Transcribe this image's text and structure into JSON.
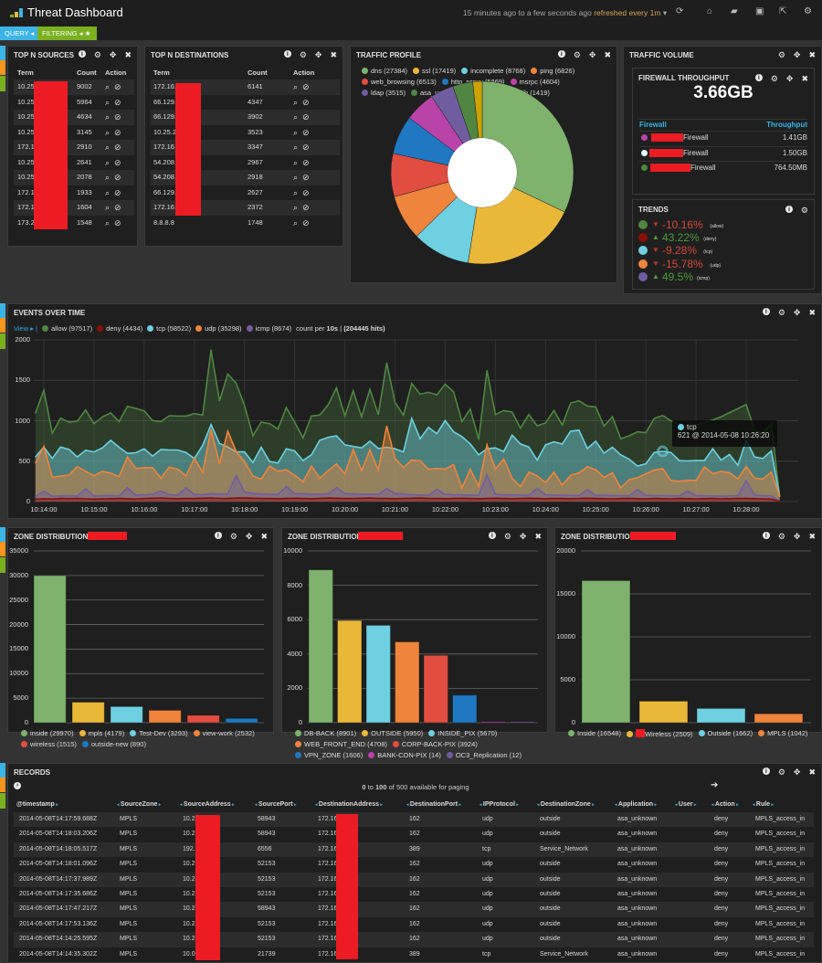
{
  "header": {
    "title": "Threat Dashboard",
    "time_range": "15 minutes ago to a few seconds ago",
    "refresh": "refreshed every 1m",
    "icons": [
      "refresh-icon",
      "home-icon",
      "folder-open-icon",
      "save-icon",
      "share-icon",
      "gear-icon"
    ]
  },
  "subnav": {
    "query": "QUERY",
    "filtering": "FILTERING"
  },
  "colors": {
    "query": "#3cb4e6",
    "filtering": "#7bb020",
    "strip_orange": "#f7941d",
    "redaction": "#ed1c24",
    "link": "#33b5e5"
  },
  "top_sources": {
    "title": "TOP N SOURCES",
    "columns": [
      "Term",
      "Count",
      "Action"
    ],
    "rows": [
      {
        "term": "10.25",
        "count": "9002"
      },
      {
        "term": "10.25",
        "count": "5964"
      },
      {
        "term": "10.25",
        "count": "4634"
      },
      {
        "term": "10.25",
        "count": "3145"
      },
      {
        "term": "172.1",
        "count": "2910"
      },
      {
        "term": "10.25",
        "count": "2641"
      },
      {
        "term": "10.25",
        "count": "2078"
      },
      {
        "term": "172.1",
        "count": "1933"
      },
      {
        "term": "172.1",
        "count": "1604"
      },
      {
        "term": "173.2",
        "count": "1548"
      }
    ]
  },
  "top_destinations": {
    "title": "TOP N DESTINATIONS",
    "columns": [
      "Term",
      "Count",
      "Action"
    ],
    "rows": [
      {
        "term": "172.16.",
        "count": "6141"
      },
      {
        "term": "66.129.",
        "count": "4347"
      },
      {
        "term": "66.129.",
        "count": "3902"
      },
      {
        "term": "10.25.2",
        "count": "3523"
      },
      {
        "term": "172.16.",
        "count": "3347"
      },
      {
        "term": "54.208.",
        "count": "2967"
      },
      {
        "term": "54.208.",
        "count": "2918"
      },
      {
        "term": "66.129.",
        "count": "2627"
      },
      {
        "term": "172.16.",
        "count": "2372"
      },
      {
        "term": "8.8.8.8",
        "count": "1748"
      }
    ]
  },
  "traffic_profile": {
    "title": "TRAFFIC PROFILE"
  },
  "traffic_volume": {
    "title": "TRAFFIC VOLUME",
    "throughput": {
      "title": "FIREWALL THROUGHPUT",
      "total": "3.66GB",
      "columns": [
        "Firewall",
        "Throughput"
      ],
      "rows": [
        {
          "name": "Firewall",
          "value": "1.41GB",
          "color": "#ba43a9"
        },
        {
          "name": "Firewall",
          "value": "1.50GB",
          "color": "#e0ffff"
        },
        {
          "name": "Firewall",
          "value": "764.50MB",
          "color": "#508642"
        }
      ]
    },
    "trends": {
      "title": "TRENDS",
      "items": [
        {
          "color": "#508642",
          "direction": "down",
          "value": "-10.16%",
          "label": "(allow)"
        },
        {
          "color": "#890f02",
          "direction": "up",
          "value": "43.22%",
          "label": "(deny)"
        },
        {
          "color": "#6ed0e0",
          "direction": "up-down",
          "value": "-9.28%",
          "label": "(tcp)"
        },
        {
          "color": "#ef843c",
          "direction": "down",
          "value": "-15.78%",
          "label": "(udp)"
        },
        {
          "color": "#705da0",
          "direction": "up",
          "value": "49.5%",
          "label": "(icmp)"
        }
      ]
    }
  },
  "events": {
    "title": "EVENTS OVER TIME",
    "view": "View",
    "count_text": "count per",
    "interval": "10s",
    "hits": "(204445 hits)",
    "tooltip": {
      "series": "tcp",
      "text": "621 @ 2014-05-08 10:26:20"
    }
  },
  "zones": [
    {
      "title": "ZONE DISTRIBUTION -"
    },
    {
      "title": "ZONE DISTRIBUTION -"
    },
    {
      "title": "ZONE DISTRIBUTION -"
    }
  ],
  "records": {
    "title": "RECORDS",
    "paging": {
      "from": "0",
      "to_word": "to",
      "to": "100",
      "rest": "of 500 available for paging"
    },
    "columns": [
      "@timestamp",
      "SourceZone",
      "SourceAddress",
      "SourcePort",
      "DestinationAddress",
      "DestinationPort",
      "IPProtocol",
      "DestinationZone",
      "Application",
      "User",
      "Action",
      "Rule"
    ],
    "rows": [
      [
        "2014-05-08T14:17:59.688Z",
        "MPLS",
        "10.25",
        "58943",
        "172.16.",
        "162",
        "udp",
        "outside",
        "asa_unknown",
        "",
        "deny",
        "MPLS_access_in"
      ],
      [
        "2014-05-08T14:18:03.206Z",
        "MPLS",
        "10.25",
        "58943",
        "172.16.",
        "162",
        "udp",
        "outside",
        "asa_unknown",
        "",
        "deny",
        "MPLS_access_in"
      ],
      [
        "2014-05-08T14:18:05.517Z",
        "MPLS",
        "192.1",
        "6556",
        "172.16.",
        "389",
        "tcp",
        "Service_Network",
        "asa_unknown",
        "",
        "deny",
        "MPLS_access_in"
      ],
      [
        "2014-05-08T14:18:01.096Z",
        "MPLS",
        "10.25",
        "52153",
        "172.16.",
        "162",
        "udp",
        "outside",
        "asa_unknown",
        "",
        "deny",
        "MPLS_access_in"
      ],
      [
        "2014-05-08T14:17:37.989Z",
        "MPLS",
        "10.25",
        "52153",
        "172.16.",
        "162",
        "udp",
        "outside",
        "asa_unknown",
        "",
        "deny",
        "MPLS_access_in"
      ],
      [
        "2014-05-08T14:17:35.686Z",
        "MPLS",
        "10.25",
        "52153",
        "172.16.",
        "162",
        "udp",
        "outside",
        "asa_unknown",
        "",
        "deny",
        "MPLS_access_in"
      ],
      [
        "2014-05-08T14:17:47.217Z",
        "MPLS",
        "10.25",
        "58943",
        "172.16.",
        "162",
        "udp",
        "outside",
        "asa_unknown",
        "",
        "deny",
        "MPLS_access_in"
      ],
      [
        "2014-05-08T14:17:53.136Z",
        "MPLS",
        "10.25",
        "52153",
        "172.16.",
        "162",
        "udp",
        "outside",
        "asa_unknown",
        "",
        "deny",
        "MPLS_access_in"
      ],
      [
        "2014-05-08T14:14:25.595Z",
        "MPLS",
        "10.25",
        "52153",
        "172.16.",
        "162",
        "udp",
        "outside",
        "asa_unknown",
        "",
        "deny",
        "MPLS_access_in"
      ],
      [
        "2014-05-08T14:14:35.302Z",
        "MPLS",
        "10.0.0",
        "21739",
        "172.16.",
        "389",
        "tcp",
        "Service_Network",
        "asa_unknown",
        "",
        "deny",
        "MPLS_access_in"
      ]
    ]
  },
  "chart_data": [
    {
      "type": "area",
      "title": "EVENTS OVER TIME",
      "start_time": "10:13:50",
      "interval": "10s",
      "ylim": [
        0,
        2000
      ],
      "yticks": [
        "0",
        "500",
        "1000",
        "1500",
        "2000"
      ],
      "xticks": [
        "10:14:00",
        "10:15:00",
        "10:16:00",
        "10:17:00",
        "10:18:00",
        "10:19:00",
        "10:20:00",
        "10:21:00",
        "10:22:00",
        "10:23:00",
        "10:24:00",
        "10:25:00",
        "10:26:00",
        "10:27:00",
        "10:28:00"
      ],
      "grid": true,
      "legend": "top-left",
      "series": [
        {
          "name": "allow",
          "total": "97517",
          "color": "#508642",
          "values": [
            1095,
            1377,
            845,
            1032,
            983,
            994,
            1133,
            964,
            1047,
            1096,
            990,
            1178,
            1152,
            1122,
            1002,
            990,
            1062,
            1058,
            1058,
            1088,
            1070,
            1876,
            1245,
            1576,
            1463,
            1190,
            814,
            983,
            964,
            897,
            1163,
            983,
            788,
            1058,
            1070,
            1197,
            1407,
            1058,
            1370,
            1047,
            1388,
            1077,
            1715,
            1227,
            1070,
            1460,
            1328,
            1351,
            1321,
            1452,
            1358,
            990,
            1145,
            769,
            1621,
            1077,
            1126,
            1107,
            908,
            1077,
            938,
            972,
            1126,
            946,
            1220,
            1246,
            1182,
            1171,
            934,
            1051,
            777,
            814,
            863,
            852,
            1028,
            1066,
            1000,
            960,
            930,
            950,
            980,
            1010,
            1050,
            1100,
            1150,
            1200,
            880,
            850,
            964,
            64
          ]
        },
        {
          "name": "deny",
          "total": "4434",
          "color": "#890f02",
          "values": [
            30,
            35,
            32,
            38,
            36,
            40,
            34,
            30,
            33,
            36,
            38,
            35,
            32,
            40,
            42,
            45,
            38,
            36,
            40,
            38,
            42,
            45,
            40,
            38,
            44,
            46,
            42,
            40,
            38,
            36,
            40,
            42,
            38,
            36,
            40,
            44,
            42,
            38,
            40,
            42,
            45,
            40,
            38,
            36,
            40,
            42,
            44,
            40,
            38,
            36,
            40,
            42,
            38,
            36,
            40,
            42,
            38,
            36,
            40,
            42,
            38,
            36,
            40,
            38,
            36,
            40,
            42,
            38,
            36,
            34,
            38,
            40,
            36,
            34,
            38,
            36,
            34,
            38,
            36,
            34,
            36,
            38,
            34,
            36,
            38,
            40,
            36,
            34,
            30,
            5
          ]
        },
        {
          "name": "tcp",
          "total": "58522",
          "color": "#6ed0e0",
          "values": [
            552,
            675,
            533,
            675,
            645,
            552,
            634,
            615,
            664,
            758,
            672,
            597,
            604,
            653,
            563,
            645,
            638,
            638,
            608,
            533,
            694,
            953,
            720,
            675,
            615,
            615,
            484,
            672,
            495,
            477,
            653,
            627,
            507,
            578,
            758,
            795,
            814,
            702,
            683,
            664,
            747,
            657,
            672,
            653,
            615,
            1028,
            777,
            919,
            841,
            1002,
            863,
            803,
            713,
            578,
            653,
            664,
            619,
            822,
            713,
            675,
            514,
            702,
            739,
            713,
            871,
            882,
            657,
            747,
            600,
            672,
            578,
            525,
            439,
            469,
            608,
            621,
            608,
            507,
            503,
            507,
            507,
            653,
            514,
            582,
            450,
            758,
            552,
            533,
            627,
            64
          ]
        },
        {
          "name": "udp",
          "total": "35298",
          "color": "#ef843c",
          "values": [
            477,
            683,
            300,
            315,
            326,
            432,
            375,
            319,
            375,
            353,
            308,
            552,
            409,
            420,
            420,
            289,
            428,
            401,
            319,
            533,
            364,
            889,
            469,
            871,
            619,
            495,
            315,
            278,
            439,
            375,
            394,
            326,
            244,
            439,
            289,
            383,
            465,
            345,
            645,
            383,
            638,
            390,
            934,
            533,
            420,
            514,
            507,
            401,
            409,
            401,
            458,
            169,
            401,
            188,
            702,
            401,
            525,
            289,
            184,
            364,
            319,
            233,
            364,
            203,
            326,
            356,
            432,
            394,
            300,
            356,
            169,
            270,
            296,
            345,
            390,
            409,
            259,
            251,
            263,
            259,
            428,
            345,
            375,
            356,
            281,
            432,
            289,
            278,
            364,
            64
          ]
        },
        {
          "name": "icmp",
          "total": "8674",
          "color": "#705da0",
          "values": [
            60,
            131,
            65,
            70,
            72,
            68,
            158,
            70,
            72,
            75,
            70,
            169,
            80,
            85,
            90,
            131,
            85,
            80,
            169,
            90,
            85,
            100,
            92,
            95,
            319,
            120,
            100,
            95,
            90,
            88,
            188,
            100,
            98,
            92,
            90,
            95,
            169,
            100,
            95,
            90,
            92,
            88,
            158,
            100,
            95,
            85,
            80,
            78,
            150,
            90,
            85,
            82,
            80,
            78,
            326,
            90,
            85,
            82,
            80,
            78,
            165,
            85,
            80,
            78,
            76,
            75,
            146,
            80,
            78,
            75,
            74,
            72,
            150,
            78,
            75,
            74,
            72,
            70,
            131,
            75,
            72,
            70,
            68,
            70,
            74,
            259,
            80,
            72,
            70,
            10
          ]
        }
      ]
    },
    {
      "type": "pie",
      "title": "TRAFFIC PROFILE",
      "donut": true,
      "legend": "top",
      "categories": [
        "dns",
        "ssl",
        "incomplete",
        "ping",
        "web_browsing",
        "http_proxy",
        "msrpc",
        "ldap",
        "asa_unknown",
        "mssql_db"
      ],
      "values": [
        27384,
        17419,
        8768,
        6826,
        6513,
        5869,
        4604,
        3515,
        3035,
        1419
      ],
      "colors": [
        "#7eb26d",
        "#eab839",
        "#6ed0e0",
        "#ef843c",
        "#e24d42",
        "#1f78c1",
        "#ba43a9",
        "#705da0",
        "#508642",
        "#cca300"
      ]
    },
    {
      "type": "bar",
      "title": "ZONE DISTRIBUTION -",
      "ylim": [
        0,
        35000
      ],
      "yticks": [
        "0",
        "5000",
        "10000",
        "15000",
        "20000",
        "25000",
        "30000",
        "35000"
      ],
      "categories": [
        "inside",
        "mpls",
        "Test-Dev",
        "view-work",
        "wireless",
        "outside-new"
      ],
      "values": [
        29970,
        4179,
        3293,
        2532,
        1515,
        890
      ],
      "colors": [
        "#7eb26d",
        "#eab839",
        "#6ed0e0",
        "#ef843c",
        "#e24d42",
        "#1f78c1"
      ]
    },
    {
      "type": "bar",
      "title": "ZONE DISTRIBUTION -",
      "ylim": [
        0,
        10000
      ],
      "yticks": [
        "0",
        "2000",
        "4000",
        "6000",
        "8000",
        "10000"
      ],
      "categories": [
        "DB-BACK",
        "OUTSIDE",
        "INSIDE_PIX",
        "WEB_FRONT_END",
        "CORP-BACK-PIX",
        "VPN_ZONE",
        "BANK-CON-PIX",
        "OC3_Replication"
      ],
      "values": [
        8901,
        5950,
        5670,
        4708,
        3924,
        1606,
        14,
        12
      ],
      "colors": [
        "#7eb26d",
        "#eab839",
        "#6ed0e0",
        "#ef843c",
        "#e24d42",
        "#1f78c1",
        "#ba43a9",
        "#705da0"
      ]
    },
    {
      "type": "bar",
      "title": "ZONE DISTRIBUTION -",
      "ylim": [
        0,
        20000
      ],
      "yticks": [
        "0",
        "5000",
        "10000",
        "15000",
        "20000"
      ],
      "categories": [
        "Inside",
        "Wireless",
        "Outside",
        "MPLS"
      ],
      "values": [
        16548,
        2509,
        1662,
        1042
      ],
      "colors": [
        "#7eb26d",
        "#eab839",
        "#6ed0e0",
        "#ef843c"
      ]
    }
  ]
}
